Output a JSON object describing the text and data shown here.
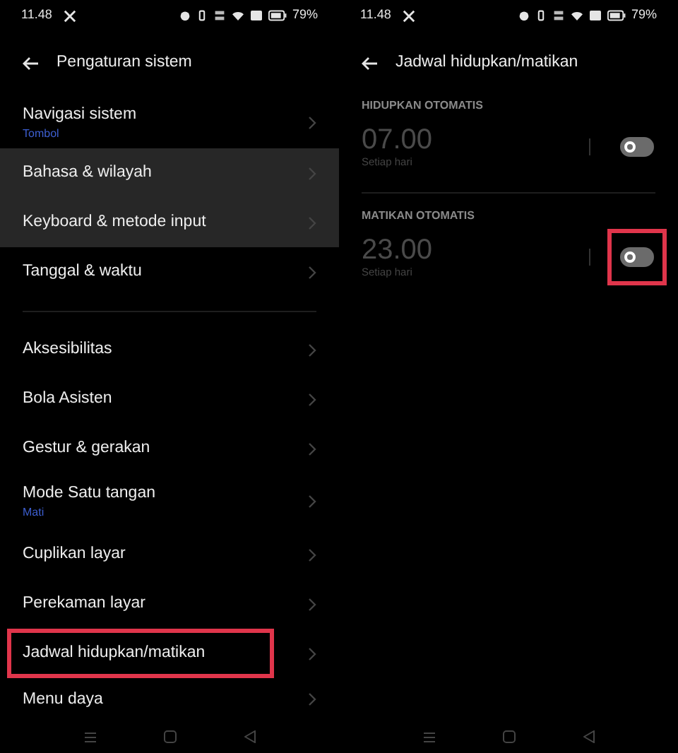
{
  "left_screen": {
    "status_bar": {
      "time": "11.48",
      "battery": "79%"
    },
    "title": "Pengaturan sistem",
    "groups": [
      [
        {
          "label": "Navigasi sistem",
          "subtitle": "Tombol",
          "selected": false,
          "highlighted": false
        },
        {
          "label": "Bahasa & wilayah",
          "selected": true,
          "highlighted": false
        },
        {
          "label": "Keyboard & metode input",
          "selected": true,
          "highlighted": false
        },
        {
          "label": "Tanggal & waktu",
          "selected": false,
          "highlighted": false
        }
      ],
      [
        {
          "label": "Aksesibilitas",
          "selected": false,
          "highlighted": false
        },
        {
          "label": "Bola Asisten",
          "selected": false,
          "highlighted": false
        },
        {
          "label": "Gestur & gerakan",
          "selected": false,
          "highlighted": false
        },
        {
          "label": "Mode Satu tangan",
          "subtitle": "Mati",
          "selected": false,
          "highlighted": false
        },
        {
          "label": "Cuplikan layar",
          "selected": false,
          "highlighted": false
        },
        {
          "label": "Perekaman layar",
          "selected": false,
          "highlighted": false
        },
        {
          "label": "Jadwal hidupkan/matikan",
          "selected": false,
          "highlighted": true
        },
        {
          "label": "Menu daya",
          "selected": false,
          "highlighted": false
        }
      ]
    ]
  },
  "right_screen": {
    "status_bar": {
      "time": "11.48",
      "battery": "79%"
    },
    "title": "Jadwal hidupkan/matikan",
    "sections": [
      {
        "heading": "HIDUPKAN OTOMATIS",
        "time": "07.00",
        "repeat": "Setiap hari",
        "on": false,
        "highlighted": false
      },
      {
        "heading": "MATIKAN OTOMATIS",
        "time": "23.00",
        "repeat": "Setiap hari",
        "on": false,
        "highlighted": true
      }
    ]
  }
}
